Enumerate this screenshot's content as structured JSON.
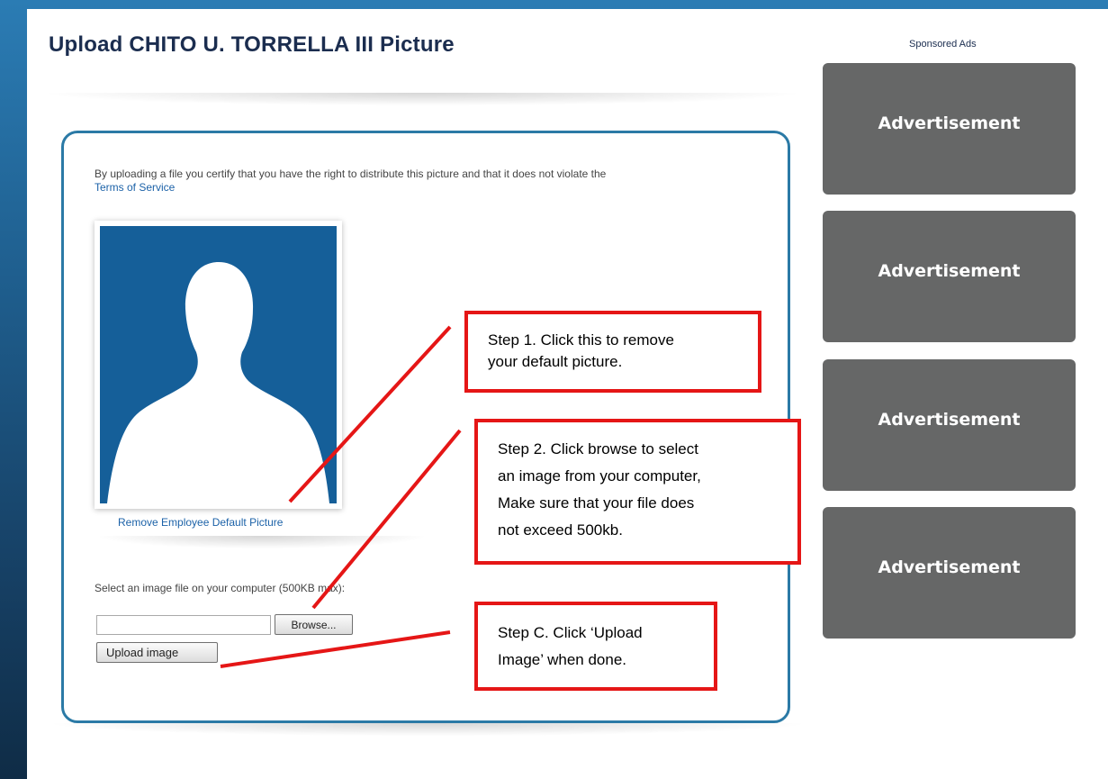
{
  "page": {
    "title": "Upload CHITO U. TORRELLA III Picture"
  },
  "upload": {
    "certify_text": "By uploading a file you certify that you have the right to distribute this picture and that it does not violate the",
    "tos_link": "Terms of Service",
    "remove_link": "Remove Employee Default Picture",
    "select_label": "Select an image file on your computer (500KB max):",
    "file_value": "",
    "browse_label": "Browse...",
    "upload_label": "Upload image"
  },
  "ads": {
    "label": "Sponsored Ads",
    "items": [
      "Advertisement",
      "Advertisement",
      "Advertisement",
      "Advertisement"
    ]
  },
  "steps": [
    {
      "lines": [
        "Step 1.  Click this to remove",
        "your default picture."
      ]
    },
    {
      "lines": [
        "Step 2.  Click browse to select",
        "an image from your computer,",
        "Make sure that your file does",
        "not exceed 500kb."
      ]
    },
    {
      "lines": [
        "Step C.  Click ‘Upload",
        "Image’ when done."
      ]
    }
  ],
  "colors": {
    "frame_blue": "#2b7aa6",
    "photo_blue": "#155f99",
    "ad_gray": "#666767",
    "annotation_red": "#e51616",
    "link_blue": "#1c62a8",
    "title_navy": "#1b2d4f"
  }
}
